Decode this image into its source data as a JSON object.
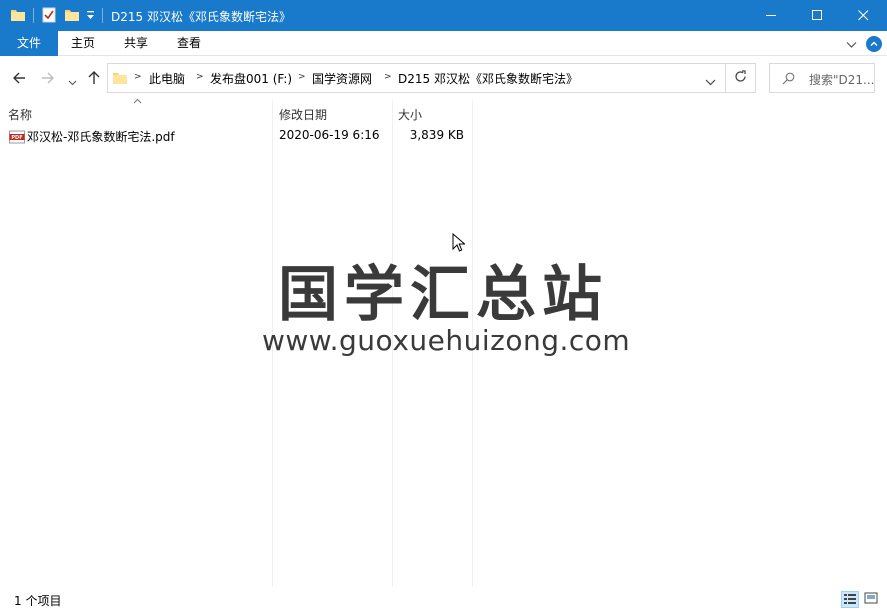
{
  "window": {
    "title": "D215 邓汉松《邓氏象数断宅法》"
  },
  "ribbon": {
    "tabs": [
      "文件",
      "主页",
      "共享",
      "查看"
    ]
  },
  "address": {
    "crumbs": [
      "此电脑",
      "发布盘001 (F:)",
      "国学资源网",
      "D215 邓汉松《邓氏象数断宅法》"
    ]
  },
  "search": {
    "placeholder": "搜索\"D21..."
  },
  "columns": {
    "name": "名称",
    "date": "修改日期",
    "size": "大小"
  },
  "files": [
    {
      "name": "邓汉松-邓氏象数断宅法.pdf",
      "date": "2020-06-19 6:16",
      "size": "3,839 KB",
      "icon": "pdf-icon"
    }
  ],
  "watermark": {
    "title": "国学汇总站",
    "url": "www.guoxuehuizong.com"
  },
  "status": {
    "count": "1 个项目"
  },
  "colors": {
    "accent": "#1979ca",
    "pdf_red": "#c8261b"
  }
}
